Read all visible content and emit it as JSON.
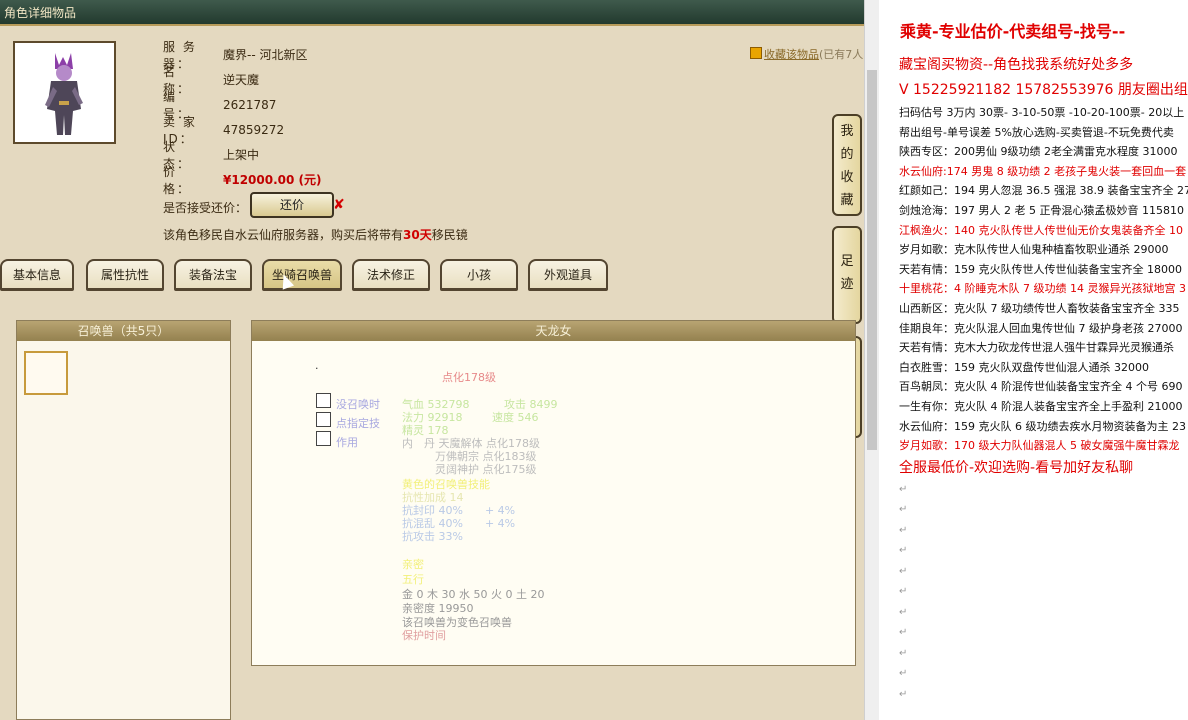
{
  "window": {
    "title": "角色详细物品"
  },
  "character": {
    "server_label": "服 务 器：",
    "server": "魔界-- 河北新区",
    "name_label": "名　　称：",
    "name": "逆天魔",
    "id_label": "编　　号：",
    "id": "2621787",
    "seller_label": "卖 家 ID：",
    "seller": "47859272",
    "status_label": "状　　态：",
    "status": "上架中",
    "price_label": "价　　格：",
    "price": "¥12000.00 (元)",
    "counter_label": "是否接受还价：",
    "counter_button": "还价",
    "migrate_prefix": "该角色移民自水云仙府服务器，购买后将带有",
    "migrate_days": "30天",
    "migrate_suffix": "移民镜"
  },
  "favorite": {
    "link": "收藏该物品",
    "count": "(已有7人"
  },
  "tabs": [
    "基本信息",
    "属性抗性",
    "装备法宝",
    "坐骑召唤兽",
    "法术修正",
    "小孩",
    "外观道具"
  ],
  "side_buttons": [
    {
      "chars": [
        "我",
        "的",
        "收",
        "藏"
      ]
    },
    {
      "chars": [
        "足",
        "迹"
      ]
    },
    {
      "chars": [
        "我",
        "的",
        "还",
        "价"
      ]
    }
  ],
  "summon_panel": {
    "header": "召唤兽（共5只）"
  },
  "pet_panel": {
    "header": "天龙女",
    "dot": ".",
    "level_line": "点化178级",
    "checks": [
      "没召唤时",
      "点指定技",
      "作用"
    ],
    "stats": [
      "气血 532798",
      "攻击 8499",
      "法力 92918",
      "速度 546",
      "精灵 178",
      "内　丹 天魔解体 点化178级",
      "　　　万佛朝宗 点化183级",
      "　　　灵阔神护 点化175级",
      "黄色的召唤兽技能",
      "抗性加成 14",
      "抗封印 40%　　+ 4%",
      "抗混乱 40%　　+ 4%",
      "抗攻击 33%",
      "亲密",
      "五行",
      "金 0 木 30 水 50 火 0 土 20",
      "亲密度 19950",
      "该召唤兽为变色召唤兽",
      "保护时间"
    ]
  },
  "notes": {
    "title": "乘黄-专业估价-代卖组号-找号--",
    "lines": [
      {
        "text": "藏宝阁买物资--角色找我系统好处多多",
        "red": true,
        "big": true
      },
      {
        "text": "V 15225921182   15782553976 朋友圈出组号",
        "red": true,
        "big": true
      },
      {
        "text": "扫码估号 3万内 30票- 3-10-50票  -10-20-100票- 20以上",
        "red": false
      },
      {
        "text": "帮出组号-单号误差 5%放心选购-买卖管退-不玩免费代卖",
        "red": false
      },
      {
        "text": "陕西专区：200男仙 9级功绩 2老全满雷克水程度 31000",
        "red": false
      },
      {
        "text": "水云仙府:174 男鬼 8 级功绩 2 老孩子鬼火装一套回血一套",
        "red": true
      },
      {
        "text": "红颜如己：194 男人忽混 36.5 强混 38.9 装备宝宝齐全 270",
        "red": false
      },
      {
        "text": "剑烛沧海：197 男人 2 老 5 正骨混心猿孟极妙音 115810",
        "red": false
      },
      {
        "text": "江枫渔火：140 克火队传世人传世仙无价女鬼装备齐全 10",
        "red": true
      },
      {
        "text": "岁月如歌：克木队传世人仙鬼种植畜牧职业通杀 29000",
        "red": false
      },
      {
        "text": "天若有情：159 克火队传世人传世仙装备宝宝齐全 18000",
        "red": false
      },
      {
        "text": "十里桃花：4 阶睡克木队 7 级功绩 14 灵猴异光孩狱地宫 3",
        "red": true
      },
      {
        "text": "山西新区：克火队 7 级功绩传世人畜牧装备宝宝齐全 335",
        "red": false
      },
      {
        "text": "佳期良年：克火队混人回血鬼传世仙 7 级护身老孩 27000",
        "red": false
      },
      {
        "text": "天若有情：克木大力砍龙传世混人强牛甘霖异光灵猴通杀",
        "red": false
      },
      {
        "text": "白衣胜雪：159 克火队双盘传世仙混人通杀 32000",
        "red": false
      },
      {
        "text": "百鸟朝凤：克火队 4 阶混传世仙装备宝宝齐全 4 个号 690",
        "red": false
      },
      {
        "text": "一生有你：克火队 4 阶混人装备宝宝齐全上手盈利 21000",
        "red": false
      },
      {
        "text": "水云仙府：159 克火队 6 级功绩去疾水月物资装备为主 23",
        "red": false
      },
      {
        "text": "岁月如歌：170 级大力队仙器混人 5 破女魔强牛魔甘霖龙",
        "red": true
      },
      {
        "text": "全服最低价-欢迎选购-看号加好友私聊",
        "red": true,
        "big": true
      }
    ],
    "para_mark": "↵"
  }
}
